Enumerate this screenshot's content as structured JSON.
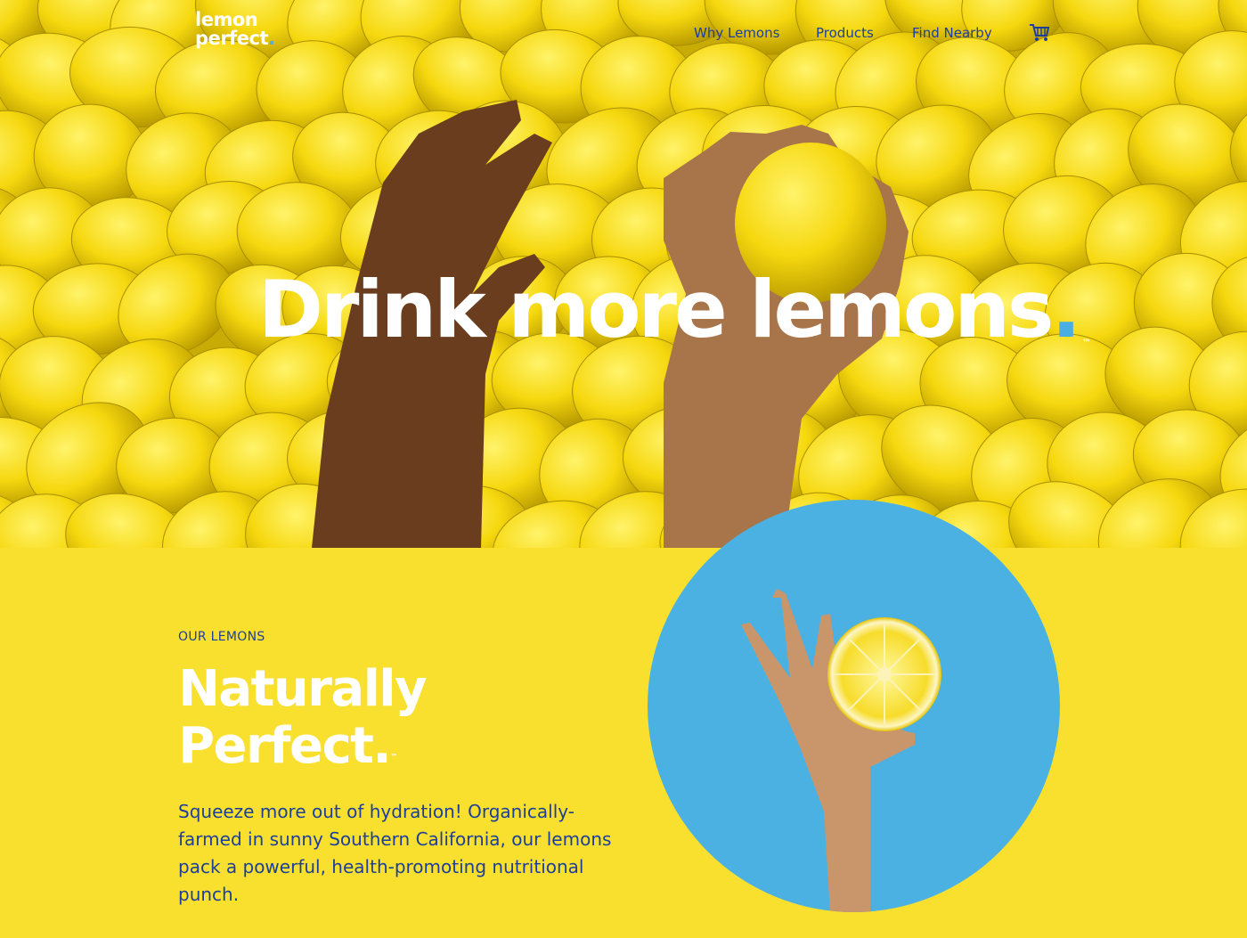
{
  "brand": {
    "logo_line1": "lemon",
    "logo_line2": "perfect",
    "logo_dot": "."
  },
  "nav": {
    "items": [
      "Why Lemons",
      "Products",
      "Find Nearby"
    ],
    "cart_icon": "cart-icon"
  },
  "hero": {
    "headline": "Drink more lemons",
    "headline_dot": ".",
    "trademark": "™"
  },
  "section": {
    "eyebrow": "OUR LEMONS",
    "title_line1": "Naturally",
    "title_line2": "Perfect",
    "title_dot": ".",
    "trademark": "™",
    "body": "Squeeze more out of hydration! Organically-farmed in sunny Southern California, our lemons pack a powerful, health-promoting nutritional punch."
  },
  "colors": {
    "brand_yellow": "#f9e02e",
    "brand_blue": "#1d3f99",
    "accent_sky": "#4aaee3",
    "white": "#ffffff"
  }
}
